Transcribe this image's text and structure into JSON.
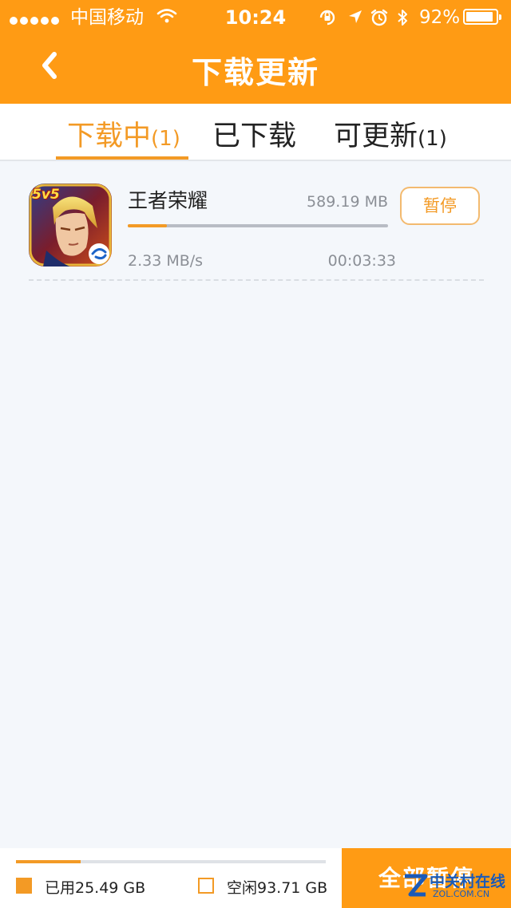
{
  "status_bar": {
    "carrier": "中国移动",
    "time": "10:24",
    "battery": "92%",
    "battery_level": 0.92
  },
  "nav": {
    "title": "下载更新"
  },
  "tabs": [
    {
      "label": "下载中",
      "count": "(1)",
      "active": true
    },
    {
      "label": "已下载",
      "count": "",
      "active": false
    },
    {
      "label": "可更新",
      "count": "(1)",
      "active": false
    }
  ],
  "downloads": [
    {
      "name": "王者荣耀",
      "size": "589.19 MB",
      "progress": 0.15,
      "speed": "2.33 MB/s",
      "remaining": "00:03:33",
      "action": "暂停",
      "icon": "honor-of-kings-app-icon",
      "badge": "5v5"
    }
  ],
  "storage": {
    "used_label": "已用25.49 GB",
    "free_label": "空闲93.71 GB",
    "used_fraction": 0.21
  },
  "footer": {
    "pause_all": "全部暂停"
  },
  "watermark": {
    "text": "中关村在线",
    "sub": "ZOL.COM.CN"
  },
  "colors": {
    "header": "#ff9b14",
    "accent": "#f39a25",
    "background": "#f4f7fb"
  }
}
